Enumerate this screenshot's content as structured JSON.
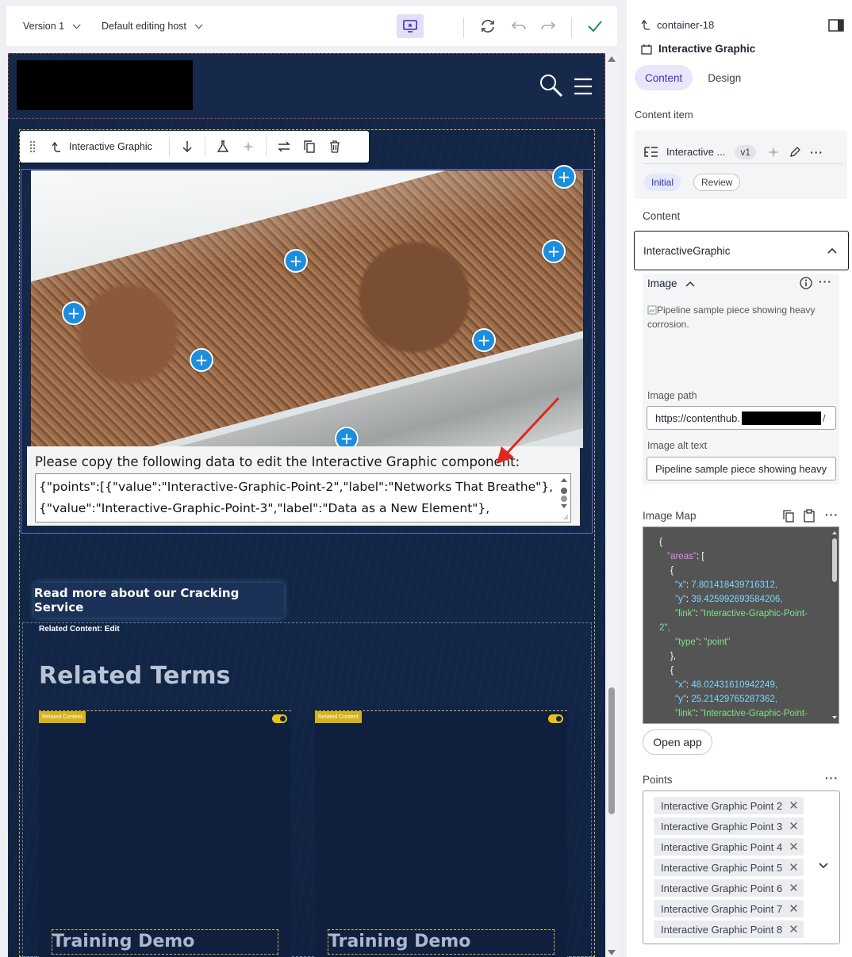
{
  "toolbar": {
    "version_label": "Version 1",
    "host_label": "Default editing host"
  },
  "canvas": {
    "component_toolbar_label": "Interactive Graphic",
    "copy_prompt": "Please copy the following data to edit the Interactive Graphic component:",
    "copy_line_1": "{\"points\":[{\"value\":\"Interactive-Graphic-Point-2\",\"label\":\"Networks That Breathe\"},",
    "copy_line_2": "{\"value\":\"Interactive-Graphic-Point-3\",\"label\":\"Data as a New Element\"},",
    "cta_label": "Read more about our Cracking Service",
    "related_edit_label": "Related Content: Edit",
    "related_title": "Related Terms",
    "cards": [
      {
        "badge": "Related Content",
        "title": "Training Demo"
      },
      {
        "badge": "Related Content",
        "title": "Training Demo"
      }
    ]
  },
  "panel": {
    "breadcrumb": "container-18",
    "title": "Interactive Graphic",
    "tabs": [
      {
        "label": "Content"
      },
      {
        "label": "Design"
      }
    ],
    "content_item_label": "Content item",
    "content_item_name": "Interactive ...",
    "content_item_version": "v1",
    "chip_initial": "Initial",
    "chip_review": "Review",
    "content_label": "Content",
    "content_dropdown": "InteractiveGraphic",
    "image_label": "Image",
    "image_alt_preview": "Pipeline sample piece showing heavy corrosion.",
    "image_path_label": "Image path",
    "image_path_value": "https://contenthub.",
    "image_alt_label": "Image alt text",
    "image_alt_value": "Pipeline sample piece showing heavy",
    "image_map_label": "Image Map",
    "open_app_label": "Open app",
    "points_label": "Points",
    "points": [
      "Interactive Graphic Point 2",
      "Interactive Graphic Point 3",
      "Interactive Graphic Point 4",
      "Interactive Graphic Point 5",
      "Interactive Graphic Point 6",
      "Interactive Graphic Point 7",
      "Interactive Graphic Point 8"
    ],
    "image_map_lines": {
      "l1": "{",
      "l2_key": "\"areas\"",
      "l2_rest": ": [",
      "l3": "{",
      "l4_key": "\"x\"",
      "l4_val": "7.801418439716312,",
      "l5_key": "\"y\"",
      "l5_val": "39.425992693584206,",
      "l6_key": "\"link\"",
      "l6_val": "\"Interactive-Graphic-Point-",
      "l7_val": "2\",",
      "l8_key": "\"type\"",
      "l8_val": "\"point\"",
      "l9": "},",
      "l10": "{",
      "l11_key": "\"x\"",
      "l11_val": "48.02431610942249,",
      "l12_key": "\"y\"",
      "l12_val": "25.21429765287362,",
      "l13_key": "\"link\"",
      "l13_val": "\"Interactive-Graphic-Point-"
    }
  },
  "colors": {
    "accent": "#3d2fb9",
    "hotspot": "#1c8ede",
    "canvas_bg": "#142544",
    "check": "#1a8a6e"
  }
}
